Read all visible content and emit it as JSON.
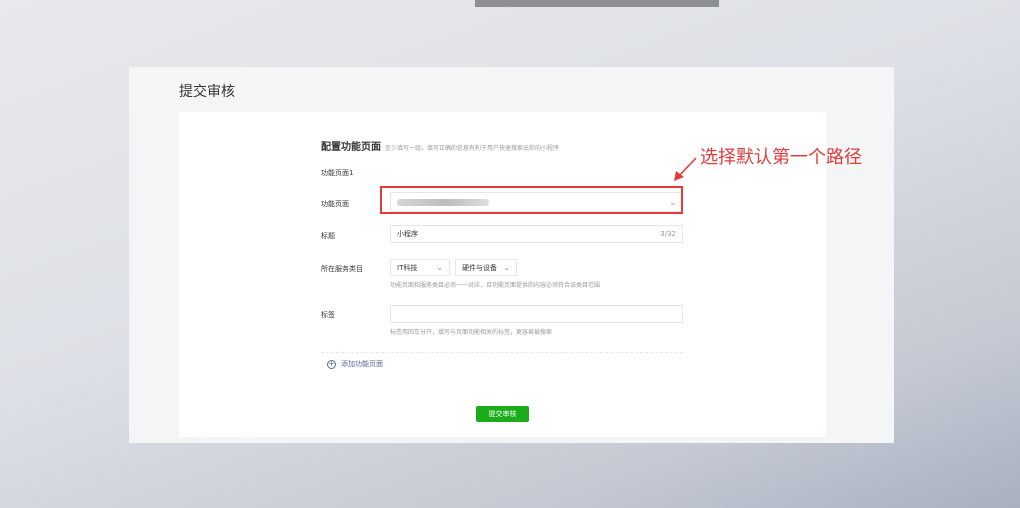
{
  "panel": {
    "title": "提交审核"
  },
  "section": {
    "title": "配置功能页面",
    "hint": "至少填写一组，填写正确的信息有利于用户快速搜索出你的小程序"
  },
  "form": {
    "group_label": "功能页面1",
    "page_label": "功能页面",
    "title_label": "标题",
    "title_value": "小程序",
    "title_count": "3/32",
    "category_label": "所在服务类目",
    "category_primary": "IT科技",
    "category_secondary": "硬件与设备",
    "category_hint": "功能页面和服务类目必须一一对应，且功能页面提供的内容必须符合该类目范围",
    "tag_label": "标签",
    "tag_value": "",
    "tag_hint": "标签用回车分开，填写与页面功能相关的标签，更容易被搜索"
  },
  "actions": {
    "add_page": "添加功能页面",
    "submit": "提交审核"
  },
  "annotation": {
    "text": "选择默认第一个路径",
    "color": "#e23b3b"
  },
  "colors": {
    "primary_button": "#1aad19",
    "link": "#576b95",
    "annotation_red": "#e23b3b"
  }
}
